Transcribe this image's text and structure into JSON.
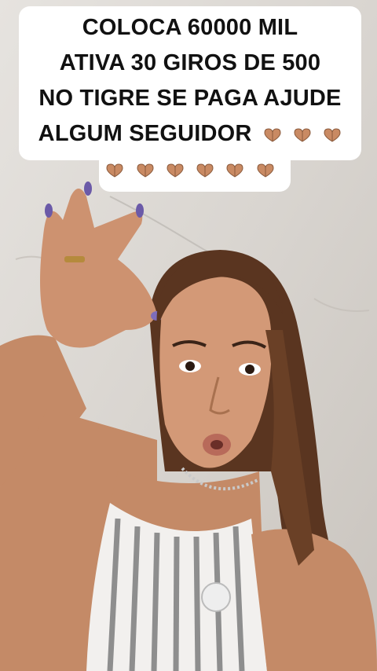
{
  "caption": {
    "lines": [
      "COLOCA 60000 MIL",
      "ATIVA 30 GIROS DE 500",
      "NO TIGRE SE PAGA AJUDE",
      "ALGUM SEGUIDOR"
    ],
    "emoji_name": "heart-hands-emoji",
    "emoji_count_line4": 3,
    "emoji_count_line5": 6
  },
  "colors": {
    "wall": "#d9d6d2",
    "caption_bg": "#ffffff",
    "caption_text": "#111111",
    "hair": "#5a3520",
    "skin": "#c98e6c",
    "nails": "#6b5aa8",
    "top_stripe": "#8e8e8e"
  }
}
